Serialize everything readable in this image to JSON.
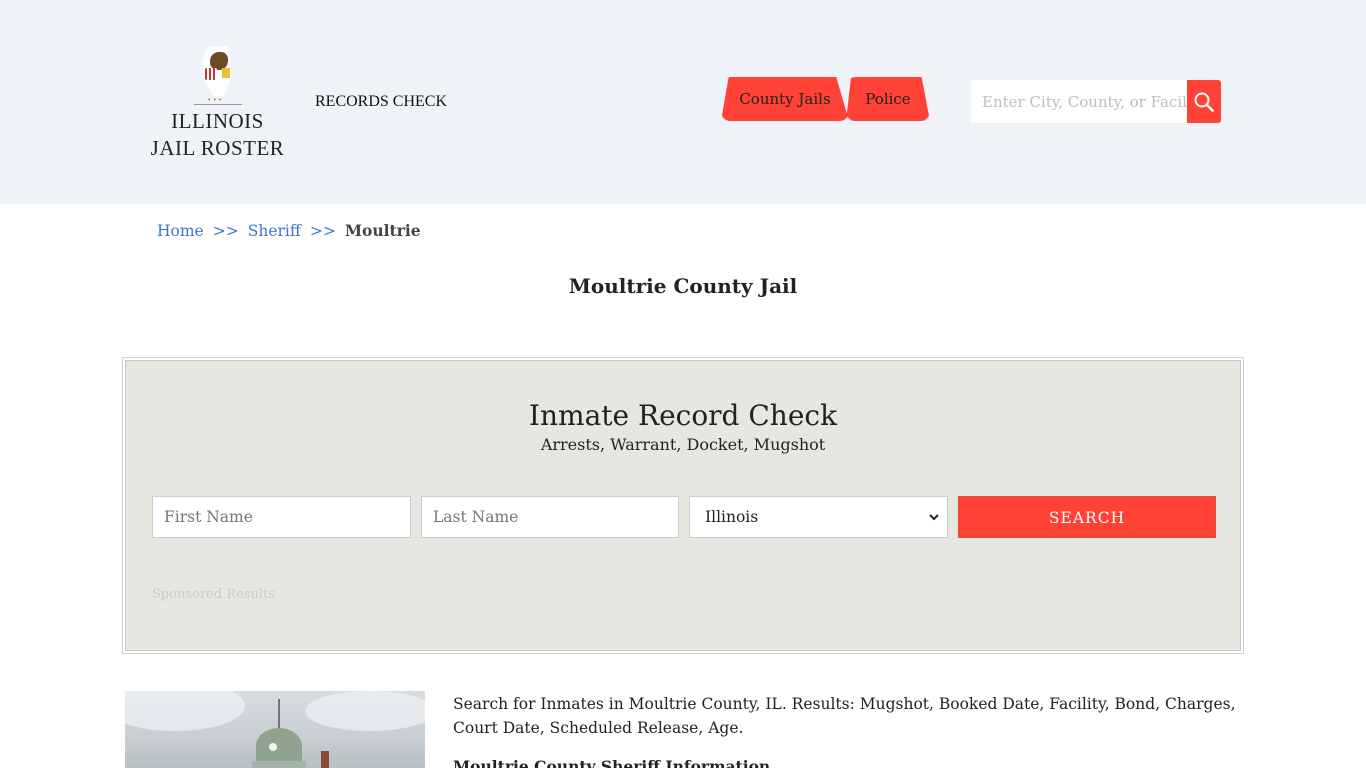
{
  "header": {
    "logo": {
      "line1": "ILLINOIS",
      "line2": "JAIL ROSTER"
    },
    "records_check_label": "RECORDS CHECK",
    "nav_tabs": [
      {
        "label": "County Jails"
      },
      {
        "label": "Police"
      }
    ],
    "search": {
      "placeholder": "Enter City, County, or Facility",
      "button_icon": "search-icon"
    }
  },
  "breadcrumb": {
    "items": [
      {
        "label": "Home"
      },
      {
        "label": "Sheriff"
      },
      {
        "label": "Moultrie"
      }
    ],
    "separator": ">>"
  },
  "page_title": "Moultrie County Jail",
  "record_check": {
    "title": "Inmate Record Check",
    "subtitle": "Arrests, Warrant, Docket, Mugshot",
    "first_name_placeholder": "First Name",
    "last_name_placeholder": "Last Name",
    "state_selected": "Illinois",
    "search_label": "SEARCH",
    "sponsored_label": "Sponsored Results"
  },
  "content": {
    "description": "Search for Inmates in Moultrie County, IL. Results: Mugshot, Booked Date, Facility, Bond, Charges, Court Date, Scheduled Release, Age.",
    "subheading": "Moultrie County Sheriff Information"
  },
  "colors": {
    "accent": "#ff4136",
    "header_bg": "#eff3f8",
    "link": "#3a78d4",
    "panel_bg": "#e8e6e1"
  }
}
